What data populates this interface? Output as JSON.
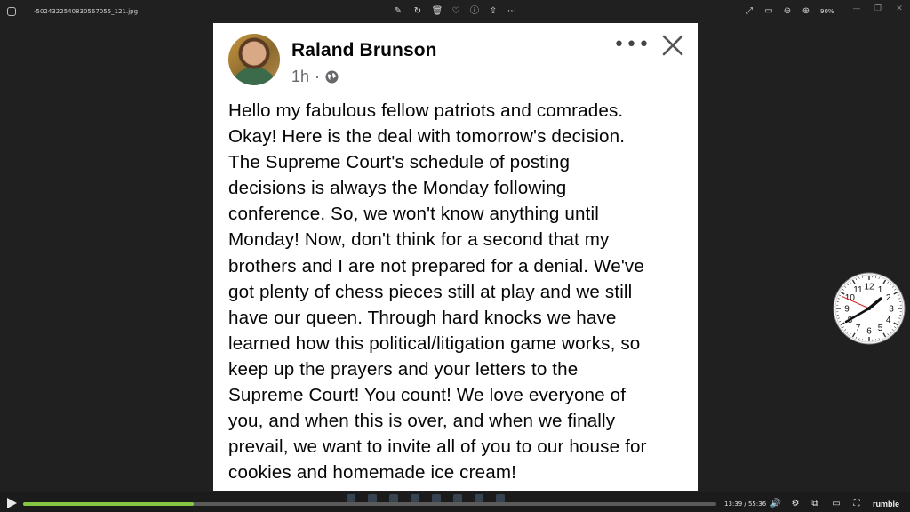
{
  "viewer": {
    "filename": "-5024322540830567055_121.jpg",
    "zoom": "90%",
    "toolbar_icons": [
      "edit-icon",
      "rotate-icon",
      "delete-icon",
      "favorite-icon",
      "info-icon",
      "share-icon",
      "more-icon"
    ],
    "right_icons": [
      "expand-icon",
      "fit-icon",
      "zoom-out-icon",
      "zoom-in-icon"
    ]
  },
  "post": {
    "author": "Raland Brunson",
    "time": "1h",
    "separator": "·",
    "more_glyph": "•••",
    "body": "Hello my fabulous fellow patriots and comrades.\nOkay!  Here is the deal with tomorrow's decision.\nThe Supreme Court's schedule of posting\ndecisions is always the Monday following\nconference.  So, we won't know anything until\nMonday!  Now, don't think for a second that my\nbrothers and I are not prepared for a denial.  We've\ngot plenty of chess pieces still at play and we still\nhave our queen.  Through hard knocks we have\nlearned how this political/litigation game works, so\nkeep up the prayers and your letters to the\nSupreme Court!  You count!  We love everyone of\nyou, and when this is over, and when we finally\nprevail, we want to invite all of you to our house for\ncookies and homemade ice cream!"
  },
  "clock": {
    "numbers": [
      "12",
      "1",
      "2",
      "3",
      "4",
      "5",
      "6",
      "7",
      "8",
      "9",
      "10",
      "11"
    ],
    "hour": 1,
    "minute": 40,
    "second": 49
  },
  "player": {
    "time": "13:39 / 55:36",
    "progress": 0.246,
    "brand": "rumble",
    "accent": "#85c742"
  }
}
